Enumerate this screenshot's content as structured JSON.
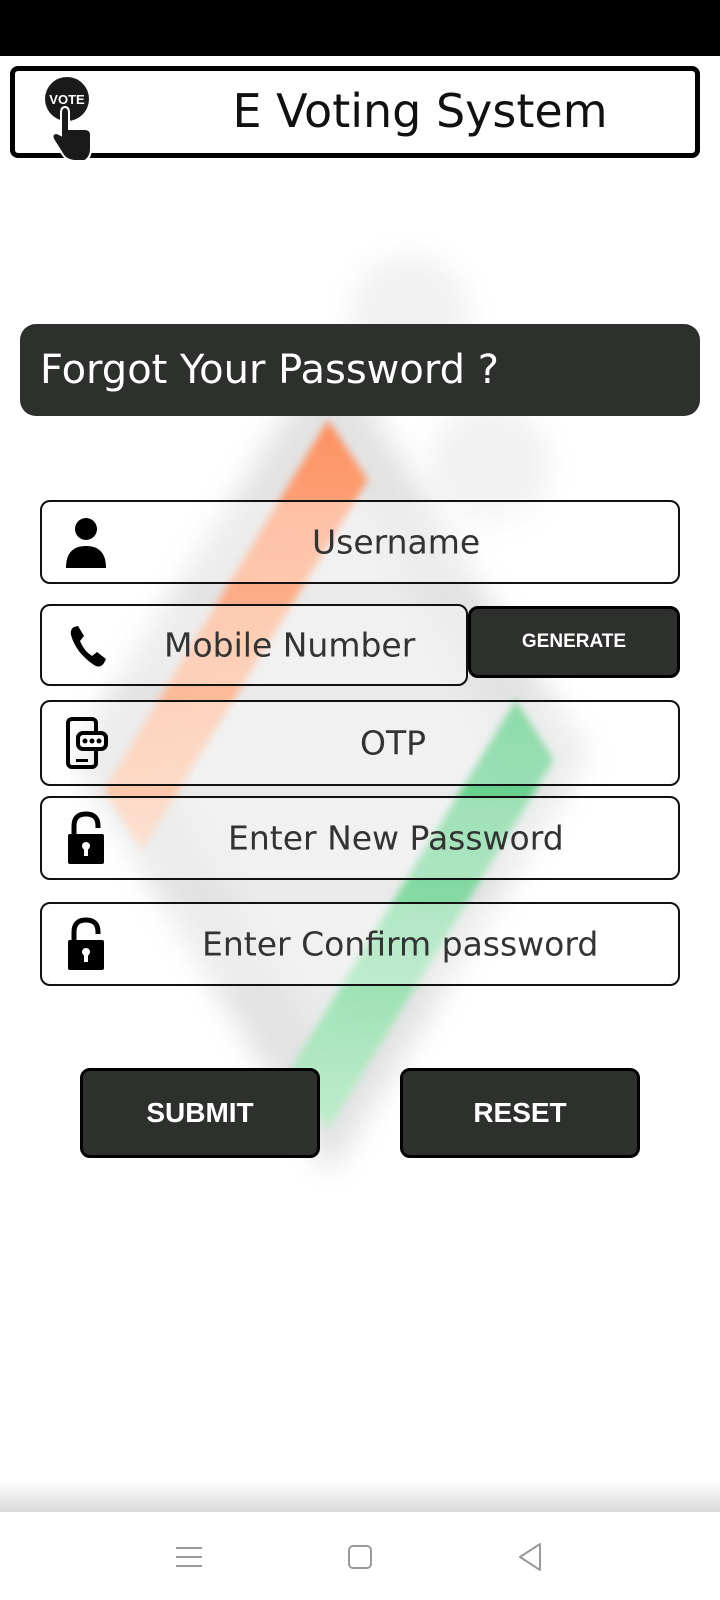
{
  "app": {
    "title": "E Voting System",
    "logo_text": "VOTE"
  },
  "banner": {
    "text": "Forgot Your Password ?"
  },
  "form": {
    "username_placeholder": "Username",
    "mobile_placeholder": "Mobile Number",
    "generate_label": "GENERATE",
    "otp_placeholder": "OTP",
    "new_password_placeholder": "Enter New Password",
    "confirm_password_placeholder": "Enter Confirm password"
  },
  "actions": {
    "submit_label": "SUBMIT",
    "reset_label": "RESET"
  },
  "colors": {
    "dark_button": "#2e302e",
    "watermark_saffron": "#ff8c5a",
    "watermark_green": "#3cc36e"
  },
  "icons": {
    "logo": "vote-hand-icon",
    "username": "person-icon",
    "mobile": "phone-icon",
    "otp": "phone-otp-icon",
    "new_password": "lock-icon",
    "confirm_password": "lock-icon",
    "nav_menu": "menu-icon",
    "nav_home": "home-square-icon",
    "nav_back": "back-triangle-icon"
  }
}
